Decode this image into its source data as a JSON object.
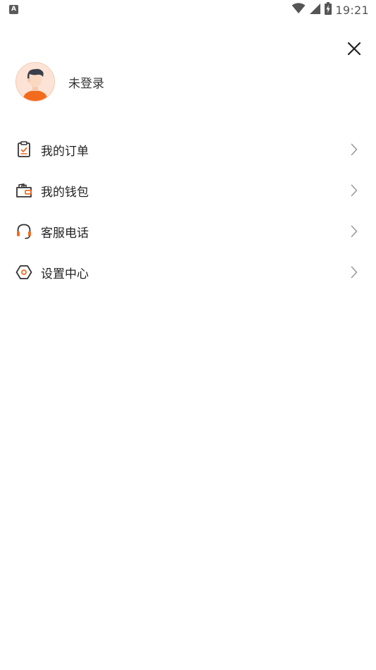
{
  "status_bar": {
    "notification_icon": "A",
    "time": "19:21",
    "icons": [
      "wifi-icon",
      "signal-icon",
      "battery-charging-icon"
    ]
  },
  "header": {
    "close_icon": "close-icon"
  },
  "profile": {
    "login_text": "未登录",
    "avatar_icon": "user-avatar"
  },
  "menu": {
    "items": [
      {
        "label": "我的订单",
        "icon": "clipboard-check-icon"
      },
      {
        "label": "我的钱包",
        "icon": "wallet-icon"
      },
      {
        "label": "客服电话",
        "icon": "headset-icon"
      },
      {
        "label": "设置中心",
        "icon": "settings-hexagon-icon"
      }
    ]
  },
  "colors": {
    "accent": "#f26b1d",
    "icon_dark": "#333333",
    "chevron": "#9a9a9a",
    "avatar_bg": "#fde3d5"
  }
}
